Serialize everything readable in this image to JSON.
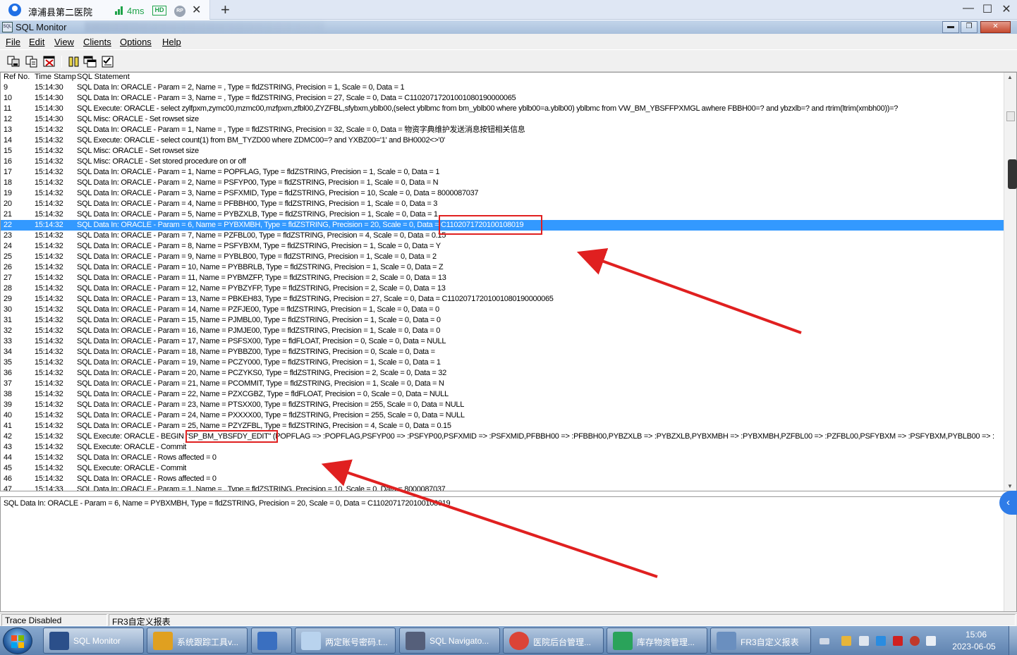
{
  "remote_desktop": {
    "tab_title": "漳浦县第二医院",
    "latency": "4ms",
    "hd_badge": "HD",
    "rp_badge": "RP",
    "close_tab": "✕",
    "new_tab": "+",
    "window_buttons": [
      "—",
      "☐",
      "✕"
    ]
  },
  "window": {
    "title": "SQL Monitor",
    "buttons": [
      "▬",
      "❐",
      "✕"
    ]
  },
  "menu": [
    "File",
    "Edit",
    "View",
    "Clients",
    "Options",
    "Help"
  ],
  "toolbar": {
    "buttons": [
      "save-log-icon",
      "copy-icon",
      "clear-icon",
      "pause-icon",
      "windows-icon",
      "checklist-icon"
    ]
  },
  "list": {
    "columns": [
      "Ref No.",
      "Time Stamp",
      "SQL Statement"
    ],
    "selected_ref": "22",
    "rows": [
      {
        "ref": "9",
        "time": "15:14:30",
        "sql": "SQL Data In: ORACLE - Param = 2, Name = , Type = fldZSTRING, Precision = 1, Scale = 0, Data = 1"
      },
      {
        "ref": "10",
        "time": "15:14:30",
        "sql": "SQL Data In: ORACLE - Param = 3, Name = , Type = fldZSTRING, Precision = 27, Scale = 0, Data = C11020717201001080190000065"
      },
      {
        "ref": "11",
        "time": "15:14:30",
        "sql": "SQL Execute: ORACLE - select zylfpxm,zymc00,mzmc00,mzfpxm,zfbl00,ZYZFBL,sfybxm,yblb00,(select yblbmc from bm_yblb00 where yblb00=a.yblb00) yblbmc from VW_BM_YBSFFPXMGL awhere  FBBH00=? and ybzxlb=? and rtrim(ltrim(xmbh00))=?"
      },
      {
        "ref": "12",
        "time": "15:14:30",
        "sql": "SQL Misc: ORACLE - Set rowset size"
      },
      {
        "ref": "13",
        "time": "15:14:32",
        "sql": "SQL Data In: ORACLE - Param = 1, Name = , Type = fldZSTRING, Precision = 32, Scale = 0, Data = 物资字典维护发送消息按钮相关信息"
      },
      {
        "ref": "14",
        "time": "15:14:32",
        "sql": "SQL Execute: ORACLE - select count(1) from BM_TYZD00 where ZDMC00=? and YXBZ00='1' and BH0002<>'0'"
      },
      {
        "ref": "15",
        "time": "15:14:32",
        "sql": "SQL Misc: ORACLE - Set rowset size"
      },
      {
        "ref": "16",
        "time": "15:14:32",
        "sql": "SQL Misc: ORACLE - Set stored procedure on or off"
      },
      {
        "ref": "17",
        "time": "15:14:32",
        "sql": "SQL Data In: ORACLE - Param = 1, Name = POPFLAG, Type = fldZSTRING, Precision = 1, Scale = 0, Data = 1"
      },
      {
        "ref": "18",
        "time": "15:14:32",
        "sql": "SQL Data In: ORACLE - Param = 2, Name = PSFYP00, Type = fldZSTRING, Precision = 1, Scale = 0, Data = N"
      },
      {
        "ref": "19",
        "time": "15:14:32",
        "sql": "SQL Data In: ORACLE - Param = 3, Name = PSFXMID, Type = fldZSTRING, Precision = 10, Scale = 0, Data = 8000087037"
      },
      {
        "ref": "20",
        "time": "15:14:32",
        "sql": "SQL Data In: ORACLE - Param = 4, Name = PFBBH00, Type = fldZSTRING, Precision = 1, Scale = 0, Data = 3"
      },
      {
        "ref": "21",
        "time": "15:14:32",
        "sql": "SQL Data In: ORACLE - Param = 5, Name = PYBZXLB, Type = fldZSTRING, Precision = 1, Scale = 0, Data = 1"
      },
      {
        "ref": "22",
        "time": "15:14:32",
        "sql": "SQL Data In: ORACLE - Param = 6, Name = PYBXMBH, Type = fldZSTRING, Precision = 20, Scale = 0, Data = C1102071720100108019"
      },
      {
        "ref": "23",
        "time": "15:14:32",
        "sql": "SQL Data In: ORACLE - Param = 7, Name = PZFBL00, Type = fldZSTRING, Precision = 4, Scale = 0, Data = 0.15"
      },
      {
        "ref": "24",
        "time": "15:14:32",
        "sql": "SQL Data In: ORACLE - Param = 8, Name = PSFYBXM, Type = fldZSTRING, Precision = 1, Scale = 0, Data = Y"
      },
      {
        "ref": "25",
        "time": "15:14:32",
        "sql": "SQL Data In: ORACLE - Param = 9, Name = PYBLB00, Type = fldZSTRING, Precision = 1, Scale = 0, Data = 2"
      },
      {
        "ref": "26",
        "time": "15:14:32",
        "sql": "SQL Data In: ORACLE - Param = 10, Name = PYBBRLB, Type = fldZSTRING, Precision = 1, Scale = 0, Data = Z"
      },
      {
        "ref": "27",
        "time": "15:14:32",
        "sql": "SQL Data In: ORACLE - Param = 11, Name = PYBMZFP, Type = fldZSTRING, Precision = 2, Scale = 0, Data = 13"
      },
      {
        "ref": "28",
        "time": "15:14:32",
        "sql": "SQL Data In: ORACLE - Param = 12, Name = PYBZYFP, Type = fldZSTRING, Precision = 2, Scale = 0, Data = 13"
      },
      {
        "ref": "29",
        "time": "15:14:32",
        "sql": "SQL Data In: ORACLE - Param = 13, Name = PBKEH83, Type = fldZSTRING, Precision = 27, Scale = 0, Data = C11020717201001080190000065"
      },
      {
        "ref": "30",
        "time": "15:14:32",
        "sql": "SQL Data In: ORACLE - Param = 14, Name = PZFJE00, Type = fldZSTRING, Precision = 1, Scale = 0, Data = 0"
      },
      {
        "ref": "31",
        "time": "15:14:32",
        "sql": "SQL Data In: ORACLE - Param = 15, Name = PJMBL00, Type = fldZSTRING, Precision = 1, Scale = 0, Data = 0"
      },
      {
        "ref": "32",
        "time": "15:14:32",
        "sql": "SQL Data In: ORACLE - Param = 16, Name = PJMJE00, Type = fldZSTRING, Precision = 1, Scale = 0, Data = 0"
      },
      {
        "ref": "33",
        "time": "15:14:32",
        "sql": "SQL Data In: ORACLE - Param = 17, Name = PSFSX00, Type = fldFLOAT, Precision = 0, Scale = 0, Data = NULL"
      },
      {
        "ref": "34",
        "time": "15:14:32",
        "sql": "SQL Data In: ORACLE - Param = 18, Name = PYBBZ00, Type = fldZSTRING, Precision = 0, Scale = 0, Data ="
      },
      {
        "ref": "35",
        "time": "15:14:32",
        "sql": "SQL Data In: ORACLE - Param = 19, Name = PCZY000, Type = fldZSTRING, Precision = 1, Scale = 0, Data = 1"
      },
      {
        "ref": "36",
        "time": "15:14:32",
        "sql": "SQL Data In: ORACLE - Param = 20, Name = PCZYKS0, Type = fldZSTRING, Precision = 2, Scale = 0, Data = 32"
      },
      {
        "ref": "37",
        "time": "15:14:32",
        "sql": "SQL Data In: ORACLE - Param = 21, Name = PCOMMIT, Type = fldZSTRING, Precision = 1, Scale = 0, Data = N"
      },
      {
        "ref": "38",
        "time": "15:14:32",
        "sql": "SQL Data In: ORACLE - Param = 22, Name = PZXCGBZ, Type = fldFLOAT, Precision = 0, Scale = 0, Data = NULL"
      },
      {
        "ref": "39",
        "time": "15:14:32",
        "sql": "SQL Data In: ORACLE - Param = 23, Name = PTSXX00, Type = fldZSTRING, Precision = 255, Scale = 0, Data = NULL"
      },
      {
        "ref": "40",
        "time": "15:14:32",
        "sql": "SQL Data In: ORACLE - Param = 24, Name = PXXXX00, Type = fldZSTRING, Precision = 255, Scale = 0, Data = NULL"
      },
      {
        "ref": "41",
        "time": "15:14:32",
        "sql": "SQL Data In: ORACLE - Param = 25, Name = PZYZFBL, Type = fldZSTRING, Precision = 4, Scale = 0, Data = 0.15"
      },
      {
        "ref": "42",
        "time": "15:14:32",
        "sql": "SQL Execute: ORACLE - BEGIN \"SP_BM_YBSFDY_EDIT\" (POPFLAG => :POPFLAG,PSFYP00 => :PSFYP00,PSFXMID => :PSFXMID,PFBBH00 => :PFBBH00,PYBZXLB => :PYBZXLB,PYBXMBH => :PYBXMBH,PZFBL00 => :PZFBL00,PSFYBXM => :PSFYBXM,PYBLB00 => :"
      },
      {
        "ref": "43",
        "time": "15:14:32",
        "sql": "SQL Execute: ORACLE - Commit"
      },
      {
        "ref": "44",
        "time": "15:14:32",
        "sql": "SQL Data In: ORACLE - Rows affected = 0"
      },
      {
        "ref": "45",
        "time": "15:14:32",
        "sql": "SQL Execute: ORACLE - Commit"
      },
      {
        "ref": "46",
        "time": "15:14:32",
        "sql": "SQL Data In: ORACLE - Rows affected = 0"
      },
      {
        "ref": "47",
        "time": "15:14:33",
        "sql": "SQL Data In: ORACLE - Param = 1, Name = , Type = fldZSTRING, Precision = 10, Scale = 0, Data = 8000087037"
      }
    ]
  },
  "detail": {
    "text": "SQL Data In: ORACLE - Param = 6, Name = PYBXMBH, Type = fldZSTRING, Precision = 20, Scale = 0, Data = C1102071720100108019"
  },
  "statusbar": {
    "trace": "Trace Disabled",
    "report": "FR3自定义报表"
  },
  "taskbar": {
    "tasks": [
      {
        "label": "SQL Monitor",
        "icon": "sql-monitor-icon",
        "active": true
      },
      {
        "label": "系统跟踪工具v...",
        "icon": "sql-trace-icon",
        "active": false
      },
      {
        "label": "",
        "icon": "network-computer-icon",
        "active": false
      },
      {
        "label": "两定账号密码.t...",
        "icon": "notepad-icon",
        "active": false
      },
      {
        "label": "SQL Navigato...",
        "icon": "sql-navigator-icon",
        "active": false
      },
      {
        "label": "医院后台管理...",
        "icon": "chrome-icon",
        "active": false
      },
      {
        "label": "库存物资管理...",
        "icon": "inventory-icon",
        "active": false
      },
      {
        "label": "FR3自定义报表",
        "icon": "tools-icon",
        "active": false
      }
    ],
    "clock_time": "15:06",
    "clock_date": "2023-06-05"
  },
  "colors": {
    "selection": "#3399ff",
    "annotation": "#e02020",
    "taskbar": "#6f92bf"
  }
}
